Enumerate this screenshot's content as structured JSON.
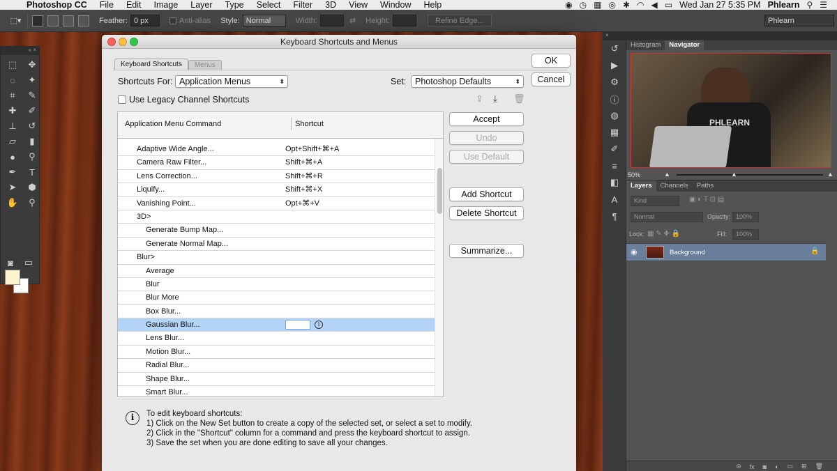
{
  "menubar": {
    "app_name": "Photoshop CC",
    "items": [
      "File",
      "Edit",
      "Image",
      "Layer",
      "Type",
      "Select",
      "Filter",
      "3D",
      "View",
      "Window",
      "Help"
    ],
    "datetime": "Wed Jan 27  5:35 PM",
    "user": "Phlearn"
  },
  "options_bar": {
    "feather_label": "Feather:",
    "feather_value": "0 px",
    "antialias_label": "Anti-alias",
    "style_label": "Style:",
    "style_value": "Normal",
    "width_label": "Width:",
    "height_label": "Height:",
    "refine_edge": "Refine Edge...",
    "workspace": "Phlearn"
  },
  "dialog": {
    "title": "Keyboard Shortcuts and Menus",
    "tabs": [
      "Keyboard Shortcuts",
      "Menus"
    ],
    "shortcuts_for_label": "Shortcuts For:",
    "shortcuts_for_value": "Application Menus",
    "set_label": "Set:",
    "set_value": "Photoshop Defaults",
    "legacy_label": "Use Legacy Channel Shortcuts",
    "col_command": "Application Menu Command",
    "col_shortcut": "Shortcut",
    "ok": "OK",
    "cancel": "Cancel",
    "accept": "Accept",
    "undo": "Undo",
    "use_default": "Use Default",
    "add_shortcut": "Add Shortcut",
    "delete_shortcut": "Delete Shortcut",
    "summarize": "Summarize...",
    "rows": [
      {
        "cmd": "Adaptive Wide Angle...",
        "shortcut": "Opt+Shift+⌘+A",
        "level": 1
      },
      {
        "cmd": "Camera Raw Filter...",
        "shortcut": "Shift+⌘+A",
        "level": 1
      },
      {
        "cmd": "Lens Correction...",
        "shortcut": "Shift+⌘+R",
        "level": 1
      },
      {
        "cmd": "Liquify...",
        "shortcut": "Shift+⌘+X",
        "level": 1
      },
      {
        "cmd": "Vanishing Point...",
        "shortcut": "Opt+⌘+V",
        "level": 1
      },
      {
        "cmd": "3D>",
        "shortcut": "",
        "level": 1
      },
      {
        "cmd": "Generate Bump Map...",
        "shortcut": "",
        "level": 2
      },
      {
        "cmd": "Generate Normal Map...",
        "shortcut": "",
        "level": 2
      },
      {
        "cmd": "Blur>",
        "shortcut": "",
        "level": 1
      },
      {
        "cmd": "Average",
        "shortcut": "",
        "level": 2
      },
      {
        "cmd": "Blur",
        "shortcut": "",
        "level": 2
      },
      {
        "cmd": "Blur More",
        "shortcut": "",
        "level": 2
      },
      {
        "cmd": "Box Blur...",
        "shortcut": "",
        "level": 2
      },
      {
        "cmd": "Gaussian Blur...",
        "shortcut": "",
        "level": 2,
        "selected": true
      },
      {
        "cmd": "Lens Blur...",
        "shortcut": "",
        "level": 2
      },
      {
        "cmd": "Motion Blur...",
        "shortcut": "",
        "level": 2
      },
      {
        "cmd": "Radial Blur...",
        "shortcut": "",
        "level": 2
      },
      {
        "cmd": "Shape Blur...",
        "shortcut": "",
        "level": 2
      },
      {
        "cmd": "Smart Blur...",
        "shortcut": "",
        "level": 2
      }
    ],
    "help_lines": [
      "To edit keyboard shortcuts:",
      "1) Click on the New Set button to create a copy of the selected set, or select a set to modify.",
      "2) Click in the \"Shortcut\" column for a command and press the keyboard shortcut to assign.",
      "3) Save the set when you are done editing to save all your changes."
    ]
  },
  "navigator": {
    "tabs": [
      "Histogram",
      "Navigator"
    ],
    "zoom": "50%",
    "shirt_text": "PHLEARN"
  },
  "layers_panel": {
    "tabs": [
      "Layers",
      "Channels",
      "Paths"
    ],
    "kind": "Kind",
    "blend": "Normal",
    "opacity_label": "Opacity:",
    "opacity_value": "100%",
    "lock_label": "Lock:",
    "fill_label": "Fill:",
    "fill_value": "100%",
    "layer_name": "Background"
  }
}
